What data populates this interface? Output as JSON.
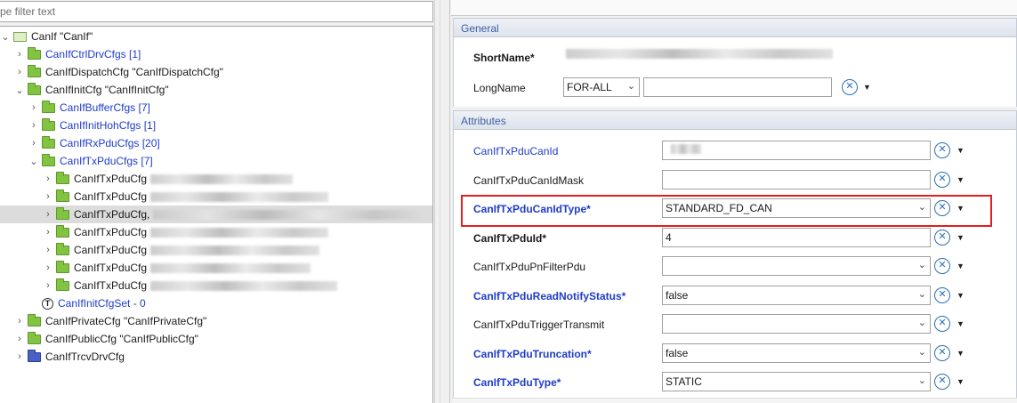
{
  "filter": {
    "placeholder_visible": "pe filter text"
  },
  "tree": [
    {
      "label": "CanIf \"CanIf\"",
      "indent": 0,
      "twisty": "open",
      "icon": "module",
      "color": "black"
    },
    {
      "label": "CanIfCtrlDrvCfgs [1]",
      "indent": 1,
      "twisty": "closed",
      "icon": "folder",
      "color": "blue"
    },
    {
      "label": "CanIfDispatchCfg \"CanIfDispatchCfg\"",
      "indent": 1,
      "twisty": "closed",
      "icon": "folder",
      "color": "black"
    },
    {
      "label": "CanIfInitCfg \"CanIfInitCfg\"",
      "indent": 1,
      "twisty": "open",
      "icon": "folder",
      "color": "black"
    },
    {
      "label": "CanIfBufferCfgs [7]",
      "indent": 2,
      "twisty": "closed",
      "icon": "folder",
      "color": "blue"
    },
    {
      "label": "CanIfInitHohCfgs [1]",
      "indent": 2,
      "twisty": "closed",
      "icon": "folder",
      "color": "blue"
    },
    {
      "label": "CanIfRxPduCfgs [20]",
      "indent": 2,
      "twisty": "closed",
      "icon": "folder",
      "color": "blue"
    },
    {
      "label": "CanIfTxPduCfgs [7]",
      "indent": 2,
      "twisty": "open",
      "icon": "folder",
      "color": "blue"
    },
    {
      "label": "CanIfTxPduCfg",
      "indent": 3,
      "twisty": "closed",
      "icon": "folder",
      "color": "black",
      "blurred": true
    },
    {
      "label": "CanIfTxPduCfg",
      "indent": 3,
      "twisty": "closed",
      "icon": "folder",
      "color": "black",
      "blurred": true
    },
    {
      "label": "CanIfTxPduCfg,",
      "indent": 3,
      "twisty": "closed",
      "icon": "folder",
      "color": "black",
      "blurred": true,
      "selected": true
    },
    {
      "label": "CanIfTxPduCfg",
      "indent": 3,
      "twisty": "closed",
      "icon": "folder",
      "color": "black",
      "blurred": true
    },
    {
      "label": "CanIfTxPduCfg",
      "indent": 3,
      "twisty": "closed",
      "icon": "folder",
      "color": "black",
      "blurred": true
    },
    {
      "label": "CanIfTxPduCfg",
      "indent": 3,
      "twisty": "closed",
      "icon": "folder",
      "color": "black",
      "blurred": true
    },
    {
      "label": "CanIfTxPduCfg",
      "indent": 3,
      "twisty": "closed",
      "icon": "folder",
      "color": "black",
      "blurred": true
    },
    {
      "label": "CanIfInitCfgSet - 0",
      "indent": 2,
      "twisty": "none",
      "icon": "t",
      "color": "blue"
    },
    {
      "label": "CanIfPrivateCfg \"CanIfPrivateCfg\"",
      "indent": 1,
      "twisty": "closed",
      "icon": "folder",
      "color": "black"
    },
    {
      "label": "CanIfPublicCfg \"CanIfPublicCfg\"",
      "indent": 1,
      "twisty": "closed",
      "icon": "folder",
      "color": "black"
    },
    {
      "label": "CanIfTrcvDrvCfg",
      "indent": 1,
      "twisty": "closed",
      "icon": "folder-blue",
      "color": "black"
    }
  ],
  "t_icon_glyph": "T",
  "general": {
    "title": "General",
    "shortname_label": "ShortName*",
    "longname_label": "LongName",
    "lang_value": "FOR-ALL",
    "longname_value": ""
  },
  "attributes": {
    "title": "Attributes",
    "rows": [
      {
        "label": "CanIfTxPduCanId",
        "bold": false,
        "blue": true,
        "kind": "text",
        "value": ""
      },
      {
        "label": "CanIfTxPduCanIdMask",
        "bold": false,
        "blue": false,
        "kind": "text",
        "value": ""
      },
      {
        "label": "CanIfTxPduCanIdType*",
        "bold": true,
        "blue": true,
        "kind": "combo",
        "value": "STANDARD_FD_CAN"
      },
      {
        "label": "CanIfTxPduId*",
        "bold": true,
        "blue": false,
        "kind": "text",
        "value": "4"
      },
      {
        "label": "CanIfTxPduPnFilterPdu",
        "bold": false,
        "blue": false,
        "kind": "combo",
        "value": ""
      },
      {
        "label": "CanIfTxPduReadNotifyStatus*",
        "bold": true,
        "blue": true,
        "kind": "combo",
        "value": "false"
      },
      {
        "label": "CanIfTxPduTriggerTransmit",
        "bold": false,
        "blue": false,
        "kind": "combo",
        "value": ""
      },
      {
        "label": "CanIfTxPduTruncation*",
        "bold": true,
        "blue": true,
        "kind": "combo",
        "value": "false"
      },
      {
        "label": "CanIfTxPduType*",
        "bold": true,
        "blue": true,
        "kind": "combo",
        "value": "STATIC"
      }
    ]
  },
  "glyphs": {
    "twisty_open": "⌄",
    "twisty_closed": "›",
    "dropdown": "⌄",
    "caret": "▼",
    "x": "✕"
  },
  "colors": {
    "link_blue": "#1e3cc8",
    "highlight_red": "#e02020",
    "folder_green": "#82c341",
    "folder_blue": "#4a60c4"
  }
}
